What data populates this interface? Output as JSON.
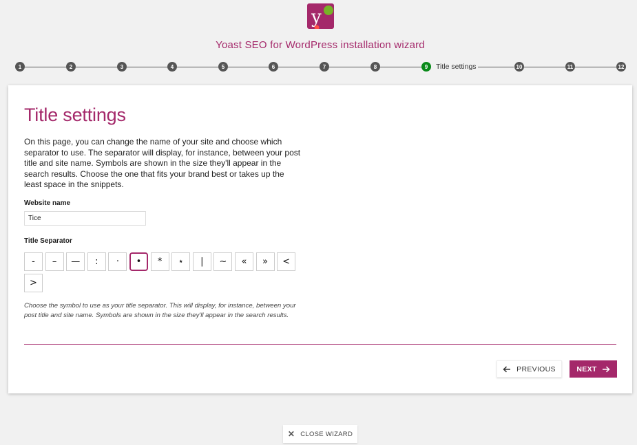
{
  "wizard": {
    "title": "Yoast SEO for WordPress installation wizard"
  },
  "stepper": {
    "steps": [
      "1",
      "2",
      "3",
      "4",
      "5",
      "6",
      "7",
      "8",
      "9",
      "10",
      "11",
      "12"
    ],
    "active_index": 9,
    "active_label": "Title settings"
  },
  "page": {
    "heading": "Title settings",
    "intro": "On this page, you can change the name of your site and choose which separator to use. The separator will display, for instance, between your post title and site name. Symbols are shown in the size they'll appear in the search results. Choose the one that fits your brand best or takes up the least space in the snippets."
  },
  "website_name": {
    "label": "Website name",
    "value": "Tice"
  },
  "title_separator": {
    "label": "Title Separator",
    "options": [
      "-",
      "–",
      "—",
      ":",
      "·",
      "•",
      "*",
      "⋆",
      "|",
      "~",
      "«",
      "»",
      "<",
      ">"
    ],
    "selected": "•",
    "help": "Choose the symbol to use as your title separator. This will display, for instance, between your post title and site name. Symbols are shown in the size they'll appear in the search results."
  },
  "buttons": {
    "previous": "PREVIOUS",
    "next": "NEXT",
    "close": "CLOSE WIZARD"
  },
  "colors": {
    "brand": "#a4286a",
    "active_step": "#0a8a1a",
    "logo_dot": "#77b227",
    "logo_accent": "#ff4e47"
  },
  "icons": {
    "logo": "yoast-logo",
    "previous": "arrow-left-icon",
    "next": "arrow-right-icon",
    "close": "close-icon"
  }
}
